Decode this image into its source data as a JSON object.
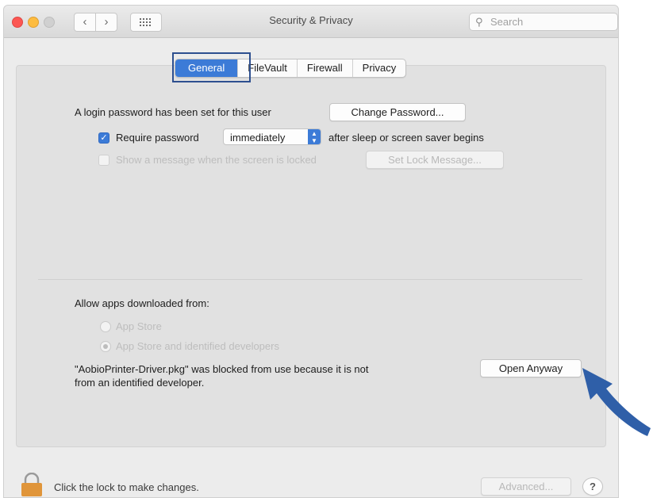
{
  "window": {
    "title": "Security & Privacy",
    "search_placeholder": "Search",
    "nav_back_icon": "chevron-left-icon",
    "nav_forward_icon": "chevron-right-icon",
    "show_all_icon": "grid-icon"
  },
  "tabs": [
    {
      "label": "General",
      "active": true
    },
    {
      "label": "FileVault",
      "active": false
    },
    {
      "label": "Firewall",
      "active": false
    },
    {
      "label": "Privacy",
      "active": false
    }
  ],
  "general": {
    "login_text": "A login password has been set for this user",
    "change_password_label": "Change Password...",
    "require_password_label": "Require password",
    "require_password_checked": true,
    "require_interval": "immediately",
    "after_text": "after sleep or screen saver begins",
    "show_message_label": "Show a message when the screen is locked",
    "show_message_checked": false,
    "set_lock_message_label": "Set Lock Message..."
  },
  "downloads": {
    "heading": "Allow apps downloaded from:",
    "options": [
      {
        "label": "App Store",
        "selected": false
      },
      {
        "label": "App Store and identified developers",
        "selected": true
      }
    ],
    "blocked_line1": "\"AobioPrinter-Driver.pkg\" was blocked from use because it is not",
    "blocked_line2": "from an identified developer.",
    "open_anyway_label": "Open Anyway"
  },
  "footer": {
    "lock_text": "Click the lock to make changes.",
    "advanced_label": "Advanced...",
    "help_label": "?"
  },
  "colors": {
    "accent": "#3c7bd7",
    "highlight_box": "#2d4f8f",
    "arrow": "#2f5fa8"
  }
}
